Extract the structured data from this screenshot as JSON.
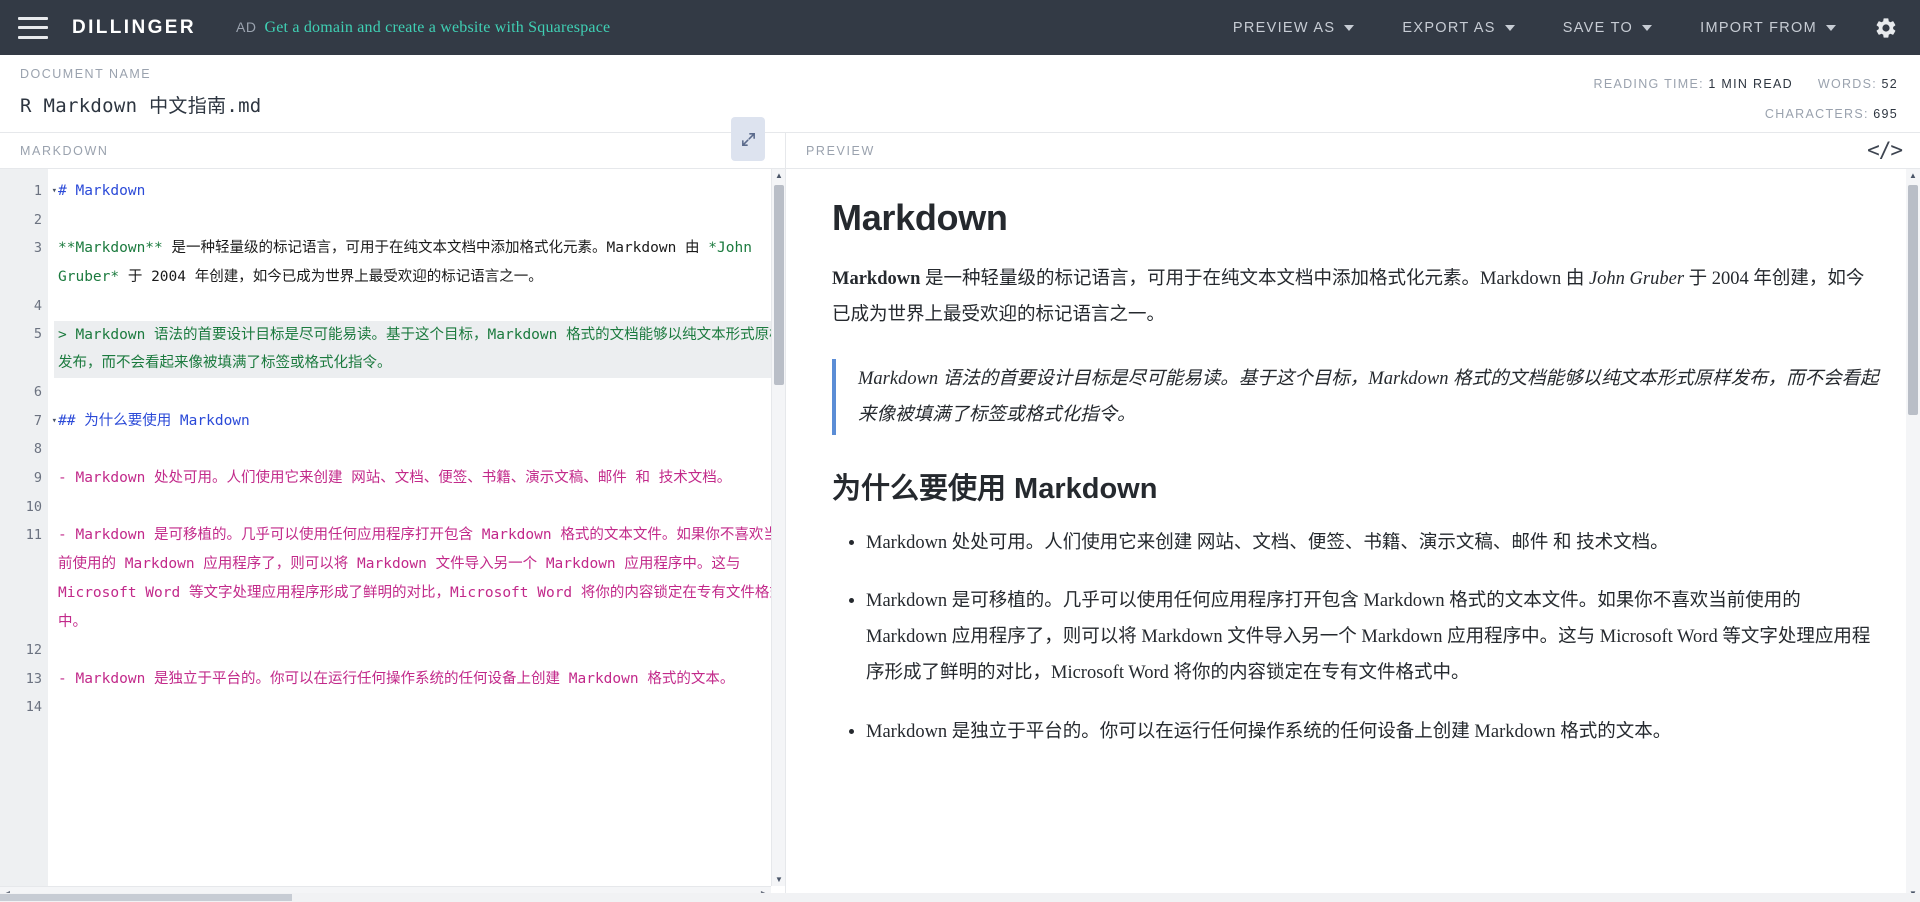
{
  "navbar": {
    "brand": "DILLINGER",
    "ad_label": "AD",
    "ad_text": "Get a domain and create a website with Squarespace",
    "menu": [
      {
        "label": "PREVIEW AS"
      },
      {
        "label": "EXPORT AS"
      },
      {
        "label": "SAVE TO"
      },
      {
        "label": "IMPORT FROM"
      }
    ],
    "settings_icon": "gear-icon",
    "hamburger_icon": "hamburger-icon"
  },
  "docbar": {
    "label": "DOCUMENT NAME",
    "name": "R Markdown 中文指南.md",
    "reading_time_key": "READING TIME:",
    "reading_time_value": "1 MIN READ",
    "words_key": "WORDS:",
    "words_value": "52",
    "characters_key": "CHARACTERS:",
    "characters_value": "695"
  },
  "editor": {
    "title": "MARKDOWN",
    "expand_icon": "expand-arrows-icon",
    "lines": [
      {
        "n": "1",
        "fold": true,
        "rows": 1,
        "active": false,
        "segments": [
          {
            "t": "# Markdown",
            "c": "tok-head"
          }
        ]
      },
      {
        "n": "2",
        "fold": false,
        "rows": 1,
        "active": false,
        "segments": [
          {
            "t": "",
            "c": "tok-plain"
          }
        ]
      },
      {
        "n": "3",
        "fold": false,
        "rows": 2,
        "active": false,
        "segments": [
          {
            "t": "**Markdown**",
            "c": "tok-em"
          },
          {
            "t": " 是一种轻量级的标记语言，可用于在纯文本文档中添加格式化元素。Markdown 由 ",
            "c": "tok-plain"
          },
          {
            "t": "*John Gruber*",
            "c": "tok-em"
          },
          {
            "t": " 于 2004 年创建，如今已成为世界上最受欢迎的标记语言之一。",
            "c": "tok-plain"
          }
        ]
      },
      {
        "n": "4",
        "fold": false,
        "rows": 1,
        "active": false,
        "segments": [
          {
            "t": "",
            "c": "tok-plain"
          }
        ]
      },
      {
        "n": "5",
        "fold": false,
        "rows": 2,
        "active": true,
        "segments": [
          {
            "t": "> Markdown 语法的首要设计目标是尽可能易读。基于这个目标，Markdown 格式的文档能够以纯文本形式原样发布，而不会看起来像被填满了标签或格式化指令。",
            "c": "tok-em"
          }
        ]
      },
      {
        "n": "6",
        "fold": false,
        "rows": 1,
        "active": false,
        "segments": [
          {
            "t": "",
            "c": "tok-plain"
          }
        ]
      },
      {
        "n": "7",
        "fold": true,
        "rows": 1,
        "active": false,
        "segments": [
          {
            "t": "## 为什么要使用 Markdown",
            "c": "tok-head"
          }
        ]
      },
      {
        "n": "8",
        "fold": false,
        "rows": 1,
        "active": false,
        "segments": [
          {
            "t": "",
            "c": "tok-plain"
          }
        ]
      },
      {
        "n": "9",
        "fold": false,
        "rows": 1,
        "active": false,
        "segments": [
          {
            "t": "- Markdown 处处可用。人们使用它来创建 网站、文档、便签、书籍、演示文稿、邮件 和 技术文档。",
            "c": "tok-list"
          }
        ]
      },
      {
        "n": "10",
        "fold": false,
        "rows": 1,
        "active": false,
        "segments": [
          {
            "t": "",
            "c": "tok-plain"
          }
        ]
      },
      {
        "n": "11",
        "fold": false,
        "rows": 4,
        "active": false,
        "segments": [
          {
            "t": "- Markdown 是可移植的。几乎可以使用任何应用程序打开包含 Markdown 格式的文本文件。如果你不喜欢当前使用的 Markdown 应用程序了，则可以将 Markdown 文件导入另一个 Markdown 应用程序中。这与 Microsoft Word 等文字处理应用程序形成了鲜明的对比，Microsoft Word 将你的内容锁定在专有文件格式中。",
            "c": "tok-list"
          }
        ]
      },
      {
        "n": "12",
        "fold": false,
        "rows": 1,
        "active": false,
        "segments": [
          {
            "t": "",
            "c": "tok-plain"
          }
        ]
      },
      {
        "n": "13",
        "fold": false,
        "rows": 1,
        "active": false,
        "segments": [
          {
            "t": "- Markdown 是独立于平台的。你可以在运行任何操作系统的任何设备上创建 Markdown 格式的文本。",
            "c": "tok-list"
          }
        ]
      },
      {
        "n": "14",
        "fold": false,
        "rows": 1,
        "active": false,
        "segments": [
          {
            "t": "",
            "c": "tok-plain"
          }
        ]
      }
    ]
  },
  "preview": {
    "title": "PREVIEW",
    "code_icon": "code-brackets-icon",
    "h1": "Markdown",
    "para1_bold": "Markdown",
    "para1_a": " 是一种轻量级的标记语言，可用于在纯文本文档中添加格式化元素。Markdown 由 ",
    "para1_em": "John Gruber",
    "para1_b": " 于 2004 年创建，如今已成为世界上最受欢迎的标记语言之一。",
    "quote": "Markdown 语法的首要设计目标是尽可能易读。基于这个目标，Markdown 格式的文档能够以纯文本形式原样发布，而不会看起来像被填满了标签或格式化指令。",
    "h2": "为什么要使用 Markdown",
    "list": [
      "Markdown 处处可用。人们使用它来创建 网站、文档、便签、书籍、演示文稿、邮件 和 技术文档。",
      "Markdown 是可移植的。几乎可以使用任何应用程序打开包含 Markdown 格式的文本文件。如果你不喜欢当前使用的 Markdown 应用程序了，则可以将 Markdown 文件导入另一个 Markdown 应用程序中。这与 Microsoft Word 等文字处理应用程序形成了鲜明的对比，Microsoft Word 将你的内容锁定在专有文件格式中。",
      "Markdown 是独立于平台的。你可以在运行任何操作系统的任何设备上创建 Markdown 格式的文本。"
    ]
  },
  "colors": {
    "navbar_bg": "#333a45",
    "ad_accent": "#3fd0b4",
    "heading_token": "#2b4ad8",
    "emphasis_token": "#1b7a3e",
    "list_token": "#c2298a",
    "quote_border": "#5b8dd6"
  }
}
